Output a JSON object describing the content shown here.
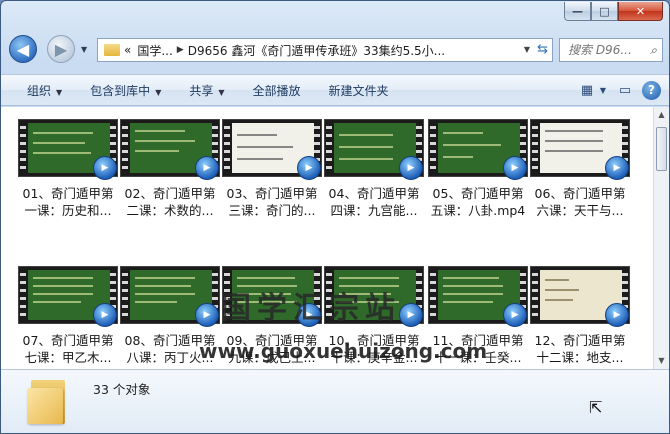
{
  "window": {
    "caption": {
      "minimize": "—",
      "maximize": "□",
      "close": "✕"
    }
  },
  "nav": {
    "back": "◀",
    "forward": "▶",
    "breadcrumb_overflow": "«",
    "breadcrumbs": [
      "国学...",
      "D9656 鑫河《奇门遁甲传承班》33集约5.5小..."
    ],
    "search_placeholder": "搜索 D96..."
  },
  "toolbar": {
    "items": [
      "组织",
      "包含到库中",
      "共享",
      "全部播放",
      "新建文件夹"
    ]
  },
  "files": [
    {
      "line1": "01、奇门遁甲第",
      "line2": "一课：历史和..."
    },
    {
      "line1": "02、奇门遁甲第",
      "line2": "二课：术数的..."
    },
    {
      "line1": "03、奇门遁甲第",
      "line2": "三课：奇门的..."
    },
    {
      "line1": "04、奇门遁甲第",
      "line2": "四课：九宫能..."
    },
    {
      "line1": "05、奇门遁甲第",
      "line2": "五课：八卦.mp4"
    },
    {
      "line1": "06、奇门遁甲第",
      "line2": "六课：天干与..."
    },
    {
      "line1": "07、奇门遁甲第",
      "line2": "七课：甲乙木..."
    },
    {
      "line1": "08、奇门遁甲第",
      "line2": "八课：丙丁火..."
    },
    {
      "line1": "09、奇门遁甲第",
      "line2": "九课：戊己土..."
    },
    {
      "line1": "10、奇门遁甲第",
      "line2": "十课：庚辛金..."
    },
    {
      "line1": "11、奇门遁甲第",
      "line2": "十一课：壬癸..."
    },
    {
      "line1": "12、奇门遁甲第",
      "line2": "十二课：地支..."
    }
  ],
  "watermark": {
    "text": "国学汇宗站",
    "url": "www.guoxuehuizong.com"
  },
  "details": {
    "count": "33 个对象"
  }
}
